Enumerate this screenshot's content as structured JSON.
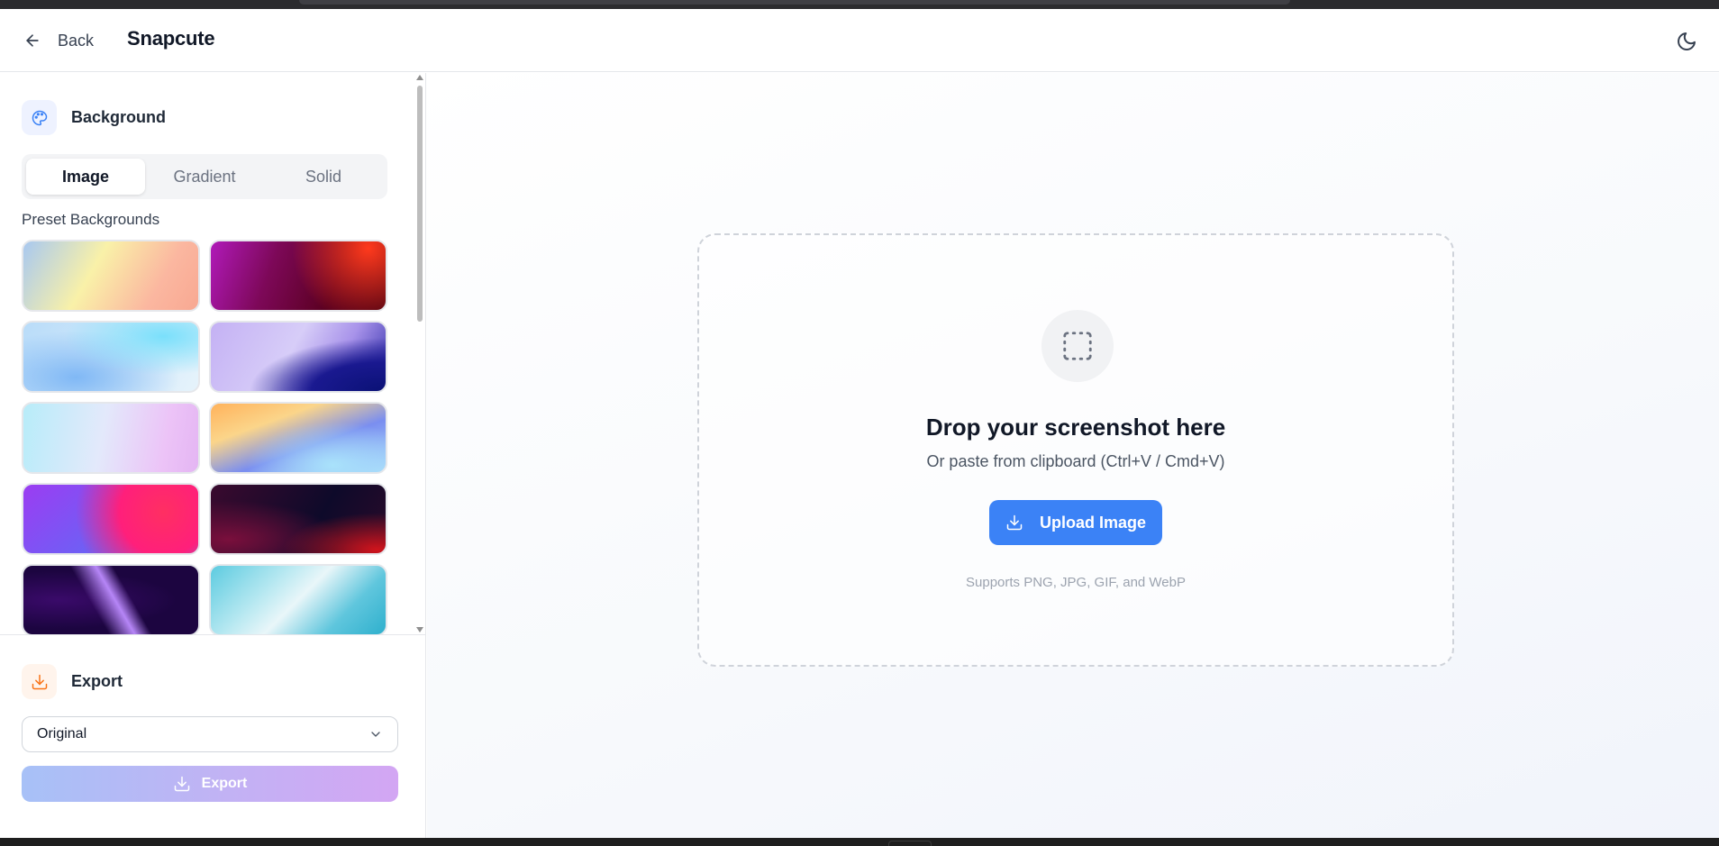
{
  "header": {
    "back_label": "Back",
    "app_title": "Snapcute"
  },
  "sidebar": {
    "background": {
      "title": "Background",
      "tabs": [
        {
          "label": "Image",
          "active": true
        },
        {
          "label": "Gradient",
          "active": false
        },
        {
          "label": "Solid",
          "active": false
        }
      ],
      "preset_label": "Preset Backgrounds",
      "presets": [
        "peach-gradient",
        "magenta-red",
        "sky-blue",
        "lavender-indigo",
        "pastel-pink-blue",
        "orange-blue-sunset",
        "violet-pink",
        "dark-crimson",
        "purple-silk",
        "aqua-silk"
      ]
    },
    "export": {
      "title": "Export",
      "size_value": "Original",
      "button_label": "Export"
    }
  },
  "dropzone": {
    "title": "Drop your screenshot here",
    "subtitle": "Or paste from clipboard (Ctrl+V / Cmd+V)",
    "upload_label": "Upload Image",
    "note": "Supports PNG, JPG, GIF, and WebP"
  },
  "colors": {
    "accent": "#3b82f6",
    "export_gradient_start": "#a7c1f7",
    "export_gradient_end": "#d3a6f3"
  }
}
